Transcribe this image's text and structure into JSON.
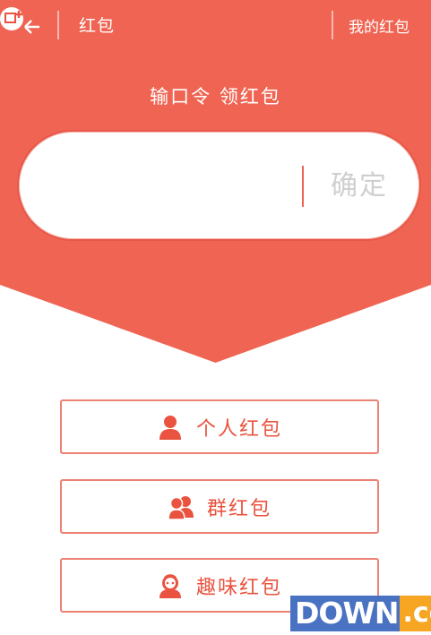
{
  "header": {
    "title": "红包",
    "my_link": "我的红包"
  },
  "subtitle": "输口令 领红包",
  "code_box": {
    "value": "",
    "confirm_label": "确定"
  },
  "options": [
    {
      "label": "个人红包",
      "icon": "person-icon"
    },
    {
      "label": "群红包",
      "icon": "group-icon"
    },
    {
      "label": "趣味红包",
      "icon": "fun-face-icon"
    }
  ],
  "watermark": {
    "text_main": "DOWN",
    "text_tail": ".cc"
  },
  "colors": {
    "accent": "#ef6452",
    "button_text": "#e9533f",
    "button_border": "#ec8274",
    "confirm_text": "#cfcfcf"
  }
}
